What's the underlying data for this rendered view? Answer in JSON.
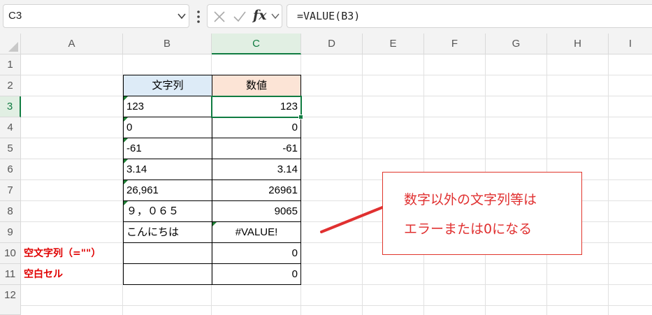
{
  "formula_bar": {
    "name_box": "C3",
    "cancel_icon": "cancel-x-icon",
    "enter_icon": "checkmark-icon",
    "fx_label": "fx",
    "formula": "=VALUE(B3)"
  },
  "columns": [
    "A",
    "B",
    "C",
    "D",
    "E",
    "F",
    "G",
    "H",
    "I"
  ],
  "selected_column": "C",
  "rows": [
    "1",
    "2",
    "3",
    "4",
    "5",
    "6",
    "7",
    "8",
    "9",
    "10",
    "11",
    "12"
  ],
  "selected_row": "3",
  "table": {
    "header_text": "文字列",
    "header_number": "数値",
    "header_text_color": "#ddebf7",
    "header_number_color": "#fce4d6",
    "rows": [
      {
        "text": "123",
        "value": "123"
      },
      {
        "text": "0",
        "value": "0"
      },
      {
        "text": "-61",
        "value": "-61"
      },
      {
        "text": "3.14",
        "value": "3.14"
      },
      {
        "text": "26,961",
        "value": "26961"
      },
      {
        "text": "９，０６５",
        "value": "9065"
      },
      {
        "text": "こんにちは",
        "value": "#VALUE!"
      },
      {
        "text": "",
        "value": "0"
      },
      {
        "text": "",
        "value": "0"
      }
    ]
  },
  "labels": {
    "row10": "空文字列（=\"\"）",
    "row11": "空白セル",
    "color": "#e00000"
  },
  "callout": {
    "line1": "数字以外の文字列等は",
    "line2": "エラーまたは0になる",
    "color": "#e03030"
  }
}
